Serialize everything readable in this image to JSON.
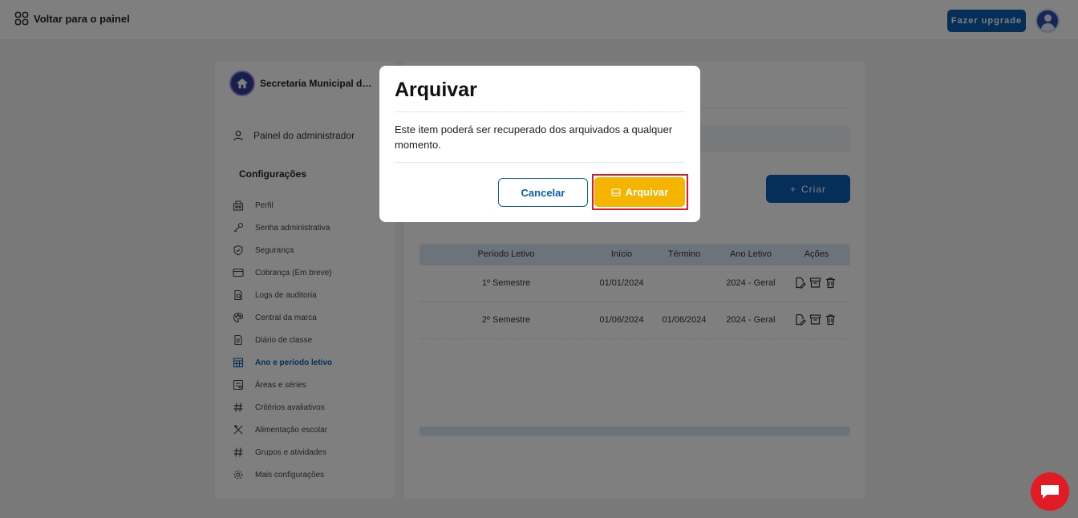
{
  "topbar": {
    "back_label": "Voltar para o painel",
    "upgrade_label": "Fazer upgrade"
  },
  "sidebar": {
    "org_name": "Secretaria Municipal de...",
    "admin_label": "Painel do administrador",
    "section_title": "Configurações",
    "items": [
      {
        "label": "Perfil",
        "icon": "building-icon"
      },
      {
        "label": "Senha administrativa",
        "icon": "key-icon"
      },
      {
        "label": "Segurança",
        "icon": "shield-icon"
      },
      {
        "label": "Cobrança (Em breve)",
        "icon": "card-icon"
      },
      {
        "label": "Logs de auditoria",
        "icon": "audit-icon"
      },
      {
        "label": "Central da marca",
        "icon": "palette-icon"
      },
      {
        "label": "Diário de classe",
        "icon": "document-icon"
      },
      {
        "label": "Ano e período letivo",
        "icon": "calendar-icon",
        "active": true
      },
      {
        "label": "Áreas e séries",
        "icon": "grid-icon"
      },
      {
        "label": "Critérios avaliativos",
        "icon": "hash-icon"
      },
      {
        "label": "Alimentação escolar",
        "icon": "utensils-icon"
      },
      {
        "label": "Grupos e atividades",
        "icon": "hash-icon"
      },
      {
        "label": "Mais configurações",
        "icon": "gear-icon"
      }
    ],
    "active_color": "#0a5fb0"
  },
  "main": {
    "create_label": "Criar",
    "table": {
      "headers": [
        "Período Letivo",
        "Início",
        "Término",
        "Ano Letivo",
        "Ações"
      ],
      "rows": [
        {
          "periodo": "1º Semestre",
          "inicio": "01/01/2024",
          "termino": "",
          "ano": "2024 - Geral"
        },
        {
          "periodo": "2º Semestre",
          "inicio": "01/06/2024",
          "termino": "01/06/2024",
          "ano": "2024 - Geral"
        }
      ]
    }
  },
  "modal": {
    "title": "Arquivar",
    "message": "Este item poderá ser recuperado dos arquivados a qualquer momento.",
    "cancel_label": "Cancelar",
    "confirm_label": "Arquivar",
    "confirm_color": "#f5b400",
    "highlight_color": "#e01b24"
  },
  "colors": {
    "primary": "#0a5fb0",
    "chat": "#e01b24"
  }
}
